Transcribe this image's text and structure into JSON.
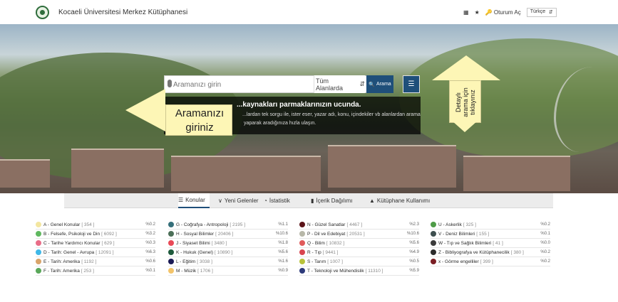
{
  "header": {
    "site_title": "Kocaeli Üniversitesi Merkez Kütüphanesi",
    "login_label": "Oturum Aç",
    "language": "Türkçe"
  },
  "search": {
    "placeholder": "Aramanızı girin",
    "scope": "Tüm Alanlarda",
    "button_label": "Arama"
  },
  "hero_info": {
    "title": "...kaynakları parmaklarınızın ucunda.",
    "desc_line1": "...lardan tek sorgu ile, ister eser, yazar adı, konu, içindekiler vb alanlardan arama",
    "desc_line2": "yaparak aradığınıza hızla ulaşın."
  },
  "annotations": {
    "left_callout": "Aramanızı giriniz",
    "right_callout": "Detaylı arama için tıklayınız"
  },
  "tabs": [
    {
      "label": "Konular"
    },
    {
      "label": "Yeni Gelenler"
    },
    {
      "label": "İstatistik"
    },
    {
      "label": "İçerik Dağılımı"
    },
    {
      "label": "Kütüphane Kullanımı"
    }
  ],
  "categories": [
    [
      {
        "label": "A - Genel Konular",
        "count": "[ 354 ]",
        "pct": "%0.2",
        "color": "#f3e6a0"
      },
      {
        "label": "B - Felsefe, Psikoloji ve Din",
        "count": "[ 6092 ]",
        "pct": "%3.2",
        "color": "#5fb85f"
      },
      {
        "label": "C - Tarihe Yardımcı Konular",
        "count": "[ 629 ]",
        "pct": "%0.3",
        "color": "#e96d88"
      },
      {
        "label": "D - Tarih: Genel - Avrupa",
        "count": "[ 12091 ]",
        "pct": "%6.3",
        "color": "#3fb8e8"
      },
      {
        "label": "E - Tarih: Amerika",
        "count": "[ 1192 ]",
        "pct": "%0.6",
        "color": "#d9a46a"
      },
      {
        "label": "F - Tarih: Amerika",
        "count": "[ 253 ]",
        "pct": "%0.1",
        "color": "#5aa85a"
      }
    ],
    [
      {
        "label": "G - Coğrafya - Antropoloji",
        "count": "[ 2195 ]",
        "pct": "%1.1",
        "color": "#356f7a"
      },
      {
        "label": "H - Sosyal Bilimler",
        "count": "[ 20406 ]",
        "pct": "%10.6",
        "color": "#4c6f58"
      },
      {
        "label": "J - Siyaset Bilimi",
        "count": "[ 3480 ]",
        "pct": "%1.8",
        "color": "#e94a57"
      },
      {
        "label": "K - Hukuk (Genel)",
        "count": "[ 10890 ]",
        "pct": "%5.6",
        "color": "#1e5a3c"
      },
      {
        "label": "L - Eğitim",
        "count": "[ 3038 ]",
        "pct": "%1.6",
        "color": "#1a1a55"
      },
      {
        "label": "M - Müzik",
        "count": "[ 1706 ]",
        "pct": "%0.9",
        "color": "#f3c46a"
      }
    ],
    [
      {
        "label": "N - Güzel Sanatlar",
        "count": "[ 4467 ]",
        "pct": "%2.3",
        "color": "#5a1218"
      },
      {
        "label": "P - Dil ve Edebiyat",
        "count": "[ 20531 ]",
        "pct": "%10.6",
        "color": "#b7b7a8"
      },
      {
        "label": "Q - Bilim",
        "count": "[ 10832 ]",
        "pct": "%5.6",
        "color": "#e05a5a"
      },
      {
        "label": "R - Tıp",
        "count": "[ 9441 ]",
        "pct": "%4.9",
        "color": "#d9454f"
      },
      {
        "label": "S - Tarım",
        "count": "[ 1007 ]",
        "pct": "%0.5",
        "color": "#b8c23a"
      },
      {
        "label": "T - Teknoloji ve Mühendislik",
        "count": "[ 11310 ]",
        "pct": "%5.9",
        "color": "#2d3a7a"
      }
    ],
    [
      {
        "label": "U - Askerlik",
        "count": "[ 325 ]",
        "pct": "%0.2",
        "color": "#4e9b47"
      },
      {
        "label": "V - Deniz Bilimleri",
        "count": "[ 155 ]",
        "pct": "%0.1",
        "color": "#3e4f4f"
      },
      {
        "label": "W - Tıp ve Sağlık Bilimleri",
        "count": "[ 41 ]",
        "pct": "%0.0",
        "color": "#3a3a3a"
      },
      {
        "label": "Z - Bibliyografya ve Kütüphanecilik",
        "count": "[ 380 ]",
        "pct": "%0.2",
        "color": "#2a2a2a"
      },
      {
        "label": "x - Görme engelliler",
        "count": "[ 399 ]",
        "pct": "%0.2",
        "color": "#7a1e24"
      }
    ]
  ]
}
